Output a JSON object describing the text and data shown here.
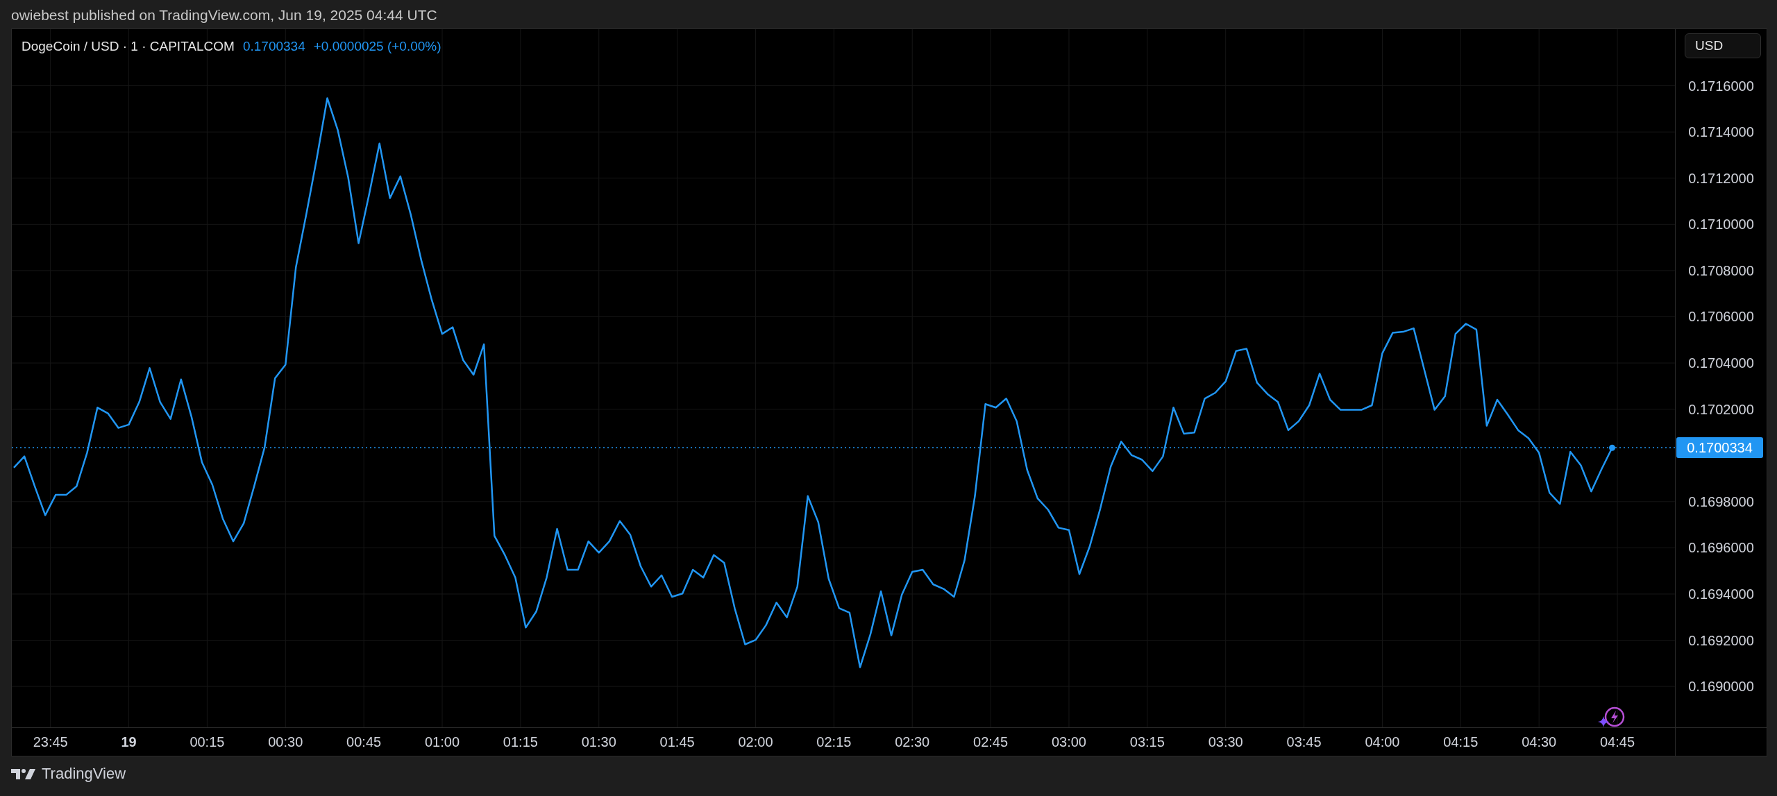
{
  "attribution": "owiebest published on TradingView.com, Jun 19, 2025 04:44 UTC",
  "chart": {
    "symbol": "DogeCoin / USD · 1 · CAPITALCOM",
    "last_price": "0.1700334",
    "change": "+0.0000025 (+0.00%)",
    "currency_button": "USD",
    "chart_data": {
      "type": "line",
      "grid": true,
      "x": [
        "2025-06-18T23:38",
        "2025-06-18T23:40",
        "2025-06-18T23:42",
        "2025-06-18T23:44",
        "2025-06-18T23:46",
        "2025-06-18T23:48",
        "2025-06-18T23:50",
        "2025-06-18T23:52",
        "2025-06-18T23:54",
        "2025-06-18T23:56",
        "2025-06-18T23:58",
        "2025-06-19T00:00",
        "2025-06-19T00:02",
        "2025-06-19T00:04",
        "2025-06-19T00:06",
        "2025-06-19T00:08",
        "2025-06-19T00:10",
        "2025-06-19T00:12",
        "2025-06-19T00:14",
        "2025-06-19T00:16",
        "2025-06-19T00:18",
        "2025-06-19T00:20",
        "2025-06-19T00:22",
        "2025-06-19T00:24",
        "2025-06-19T00:26",
        "2025-06-19T00:28",
        "2025-06-19T00:30",
        "2025-06-19T00:32",
        "2025-06-19T00:34",
        "2025-06-19T00:36",
        "2025-06-19T00:38",
        "2025-06-19T00:40",
        "2025-06-19T00:42",
        "2025-06-19T00:44",
        "2025-06-19T00:46",
        "2025-06-19T00:48",
        "2025-06-19T00:50",
        "2025-06-19T00:52",
        "2025-06-19T00:54",
        "2025-06-19T00:56",
        "2025-06-19T00:58",
        "2025-06-19T01:00",
        "2025-06-19T01:02",
        "2025-06-19T01:04",
        "2025-06-19T01:06",
        "2025-06-19T01:08",
        "2025-06-19T01:10",
        "2025-06-19T01:12",
        "2025-06-19T01:14",
        "2025-06-19T01:16",
        "2025-06-19T01:18",
        "2025-06-19T01:20",
        "2025-06-19T01:22",
        "2025-06-19T01:24",
        "2025-06-19T01:26",
        "2025-06-19T01:28",
        "2025-06-19T01:30",
        "2025-06-19T01:32",
        "2025-06-19T01:34",
        "2025-06-19T01:36",
        "2025-06-19T01:38",
        "2025-06-19T01:40",
        "2025-06-19T01:42",
        "2025-06-19T01:44",
        "2025-06-19T01:46",
        "2025-06-19T01:48",
        "2025-06-19T01:50",
        "2025-06-19T01:52",
        "2025-06-19T01:54",
        "2025-06-19T01:56",
        "2025-06-19T01:58",
        "2025-06-19T02:00",
        "2025-06-19T02:02",
        "2025-06-19T02:04",
        "2025-06-19T02:06",
        "2025-06-19T02:08",
        "2025-06-19T02:10",
        "2025-06-19T02:12",
        "2025-06-19T02:14",
        "2025-06-19T02:16",
        "2025-06-19T02:18",
        "2025-06-19T02:20",
        "2025-06-19T02:22",
        "2025-06-19T02:24",
        "2025-06-19T02:26",
        "2025-06-19T02:28",
        "2025-06-19T02:30",
        "2025-06-19T02:32",
        "2025-06-19T02:34",
        "2025-06-19T02:36",
        "2025-06-19T02:38",
        "2025-06-19T02:40",
        "2025-06-19T02:42",
        "2025-06-19T02:44",
        "2025-06-19T02:46",
        "2025-06-19T02:48",
        "2025-06-19T02:50",
        "2025-06-19T02:52",
        "2025-06-19T02:54",
        "2025-06-19T02:56",
        "2025-06-19T02:58",
        "2025-06-19T03:00",
        "2025-06-19T03:02",
        "2025-06-19T03:04",
        "2025-06-19T03:06",
        "2025-06-19T03:08",
        "2025-06-19T03:10",
        "2025-06-19T03:12",
        "2025-06-19T03:14",
        "2025-06-19T03:16",
        "2025-06-19T03:18",
        "2025-06-19T03:20",
        "2025-06-19T03:22",
        "2025-06-19T03:24",
        "2025-06-19T03:26",
        "2025-06-19T03:28",
        "2025-06-19T03:30",
        "2025-06-19T03:32",
        "2025-06-19T03:34",
        "2025-06-19T03:36",
        "2025-06-19T03:38",
        "2025-06-19T03:40",
        "2025-06-19T03:42",
        "2025-06-19T03:44",
        "2025-06-19T03:46",
        "2025-06-19T03:48",
        "2025-06-19T03:50",
        "2025-06-19T03:52",
        "2025-06-19T03:54",
        "2025-06-19T03:56",
        "2025-06-19T03:58",
        "2025-06-19T04:00",
        "2025-06-19T04:02",
        "2025-06-19T04:04",
        "2025-06-19T04:06",
        "2025-06-19T04:08",
        "2025-06-19T04:10",
        "2025-06-19T04:12",
        "2025-06-19T04:14",
        "2025-06-19T04:16",
        "2025-06-19T04:18",
        "2025-06-19T04:20",
        "2025-06-19T04:22",
        "2025-06-19T04:24",
        "2025-06-19T04:26",
        "2025-06-19T04:28",
        "2025-06-19T04:30",
        "2025-06-19T04:32",
        "2025-06-19T04:34",
        "2025-06-19T04:36",
        "2025-06-19T04:38",
        "2025-06-19T04:40",
        "2025-06-19T04:42",
        "2025-06-19T04:44"
      ],
      "series": [
        {
          "color": "#2196f3",
          "values": [
            0.169947,
            0.169996,
            0.169866,
            0.169741,
            0.169829,
            0.169829,
            0.169866,
            0.170011,
            0.170207,
            0.170182,
            0.170119,
            0.170133,
            0.170231,
            0.170378,
            0.170231,
            0.170158,
            0.170329,
            0.170168,
            0.169971,
            0.169873,
            0.169726,
            0.169628,
            0.169706,
            0.169866,
            0.170035,
            0.170334,
            0.170393,
            0.170815,
            0.171046,
            0.171286,
            0.171546,
            0.171409,
            0.171203,
            0.170918,
            0.171129,
            0.17135,
            0.171114,
            0.171208,
            0.171041,
            0.170845,
            0.170673,
            0.170526,
            0.170555,
            0.170413,
            0.170349,
            0.170481,
            0.169652,
            0.169569,
            0.169471,
            0.169255,
            0.169324,
            0.169471,
            0.169682,
            0.169505,
            0.169505,
            0.169628,
            0.169579,
            0.169628,
            0.169716,
            0.169657,
            0.16952,
            0.169432,
            0.169481,
            0.169388,
            0.169402,
            0.169505,
            0.169471,
            0.169569,
            0.169535,
            0.169339,
            0.169182,
            0.169201,
            0.169265,
            0.169363,
            0.169299,
            0.169432,
            0.169824,
            0.169711,
            0.169466,
            0.169339,
            0.169319,
            0.169083,
            0.169226,
            0.169412,
            0.169221,
            0.169397,
            0.169496,
            0.169505,
            0.169442,
            0.169422,
            0.169388,
            0.169545,
            0.169824,
            0.170222,
            0.170207,
            0.170246,
            0.170148,
            0.169937,
            0.169814,
            0.169765,
            0.169687,
            0.169677,
            0.169486,
            0.169608,
            0.16977,
            0.169952,
            0.17006,
            0.170001,
            0.169981,
            0.169932,
            0.169996,
            0.170207,
            0.170094,
            0.170099,
            0.170246,
            0.170271,
            0.17032,
            0.170452,
            0.170462,
            0.170315,
            0.170266,
            0.170231,
            0.170109,
            0.170148,
            0.170217,
            0.170354,
            0.170241,
            0.170197,
            0.170197,
            0.170197,
            0.170217,
            0.170442,
            0.170531,
            0.170535,
            0.17055,
            0.170374,
            0.170197,
            0.170256,
            0.170526,
            0.17057,
            0.170545,
            0.170128,
            0.170241,
            0.170177,
            0.170109,
            0.170074,
            0.170011,
            0.169839,
            0.16979,
            0.170016,
            0.169957,
            0.169844,
            0.169942,
            0.170033
          ]
        }
      ],
      "ref_lines": [
        {
          "axis": "y",
          "value": 0.1700334,
          "label": "0.1700334",
          "color": "#2196f3"
        }
      ],
      "xlim": [
        "2025-06-18T23:37:36",
        "2025-06-19T05:13:42"
      ],
      "ylim": [
        0.168697,
        0.171845
      ],
      "xticks": [
        {
          "value": "2025-06-18T23:45",
          "label": "23:45"
        },
        {
          "value": "2025-06-19T00:00",
          "label": "19"
        },
        {
          "value": "2025-06-19T00:15",
          "label": "00:15"
        },
        {
          "value": "2025-06-19T00:30",
          "label": "00:30"
        },
        {
          "value": "2025-06-19T00:45",
          "label": "00:45"
        },
        {
          "value": "2025-06-19T01:00",
          "label": "01:00"
        },
        {
          "value": "2025-06-19T01:15",
          "label": "01:15"
        },
        {
          "value": "2025-06-19T01:30",
          "label": "01:30"
        },
        {
          "value": "2025-06-19T01:45",
          "label": "01:45"
        },
        {
          "value": "2025-06-19T02:00",
          "label": "02:00"
        },
        {
          "value": "2025-06-19T02:15",
          "label": "02:15"
        },
        {
          "value": "2025-06-19T02:30",
          "label": "02:30"
        },
        {
          "value": "2025-06-19T02:45",
          "label": "02:45"
        },
        {
          "value": "2025-06-19T03:00",
          "label": "03:00"
        },
        {
          "value": "2025-06-19T03:15",
          "label": "03:15"
        },
        {
          "value": "2025-06-19T03:30",
          "label": "03:30"
        },
        {
          "value": "2025-06-19T03:45",
          "label": "03:45"
        },
        {
          "value": "2025-06-19T04:00",
          "label": "04:00"
        },
        {
          "value": "2025-06-19T04:15",
          "label": "04:15"
        },
        {
          "value": "2025-06-19T04:30",
          "label": "04:30"
        },
        {
          "value": "2025-06-19T04:45",
          "label": "04:45"
        }
      ],
      "yticks": [
        {
          "value": 0.1716,
          "label": "0.1716000"
        },
        {
          "value": 0.1714,
          "label": "0.1714000"
        },
        {
          "value": 0.1712,
          "label": "0.1712000"
        },
        {
          "value": 0.171,
          "label": "0.1710000"
        },
        {
          "value": 0.1708,
          "label": "0.1708000"
        },
        {
          "value": 0.1706,
          "label": "0.1706000"
        },
        {
          "value": 0.1704,
          "label": "0.1704000"
        },
        {
          "value": 0.1702,
          "label": "0.1702000"
        },
        {
          "value": 0.1698,
          "label": "0.1698000"
        },
        {
          "value": 0.1696,
          "label": "0.1696000"
        },
        {
          "value": 0.1694,
          "label": "0.1694000"
        },
        {
          "value": 0.1692,
          "label": "0.1692000"
        },
        {
          "value": 0.169,
          "label": "0.1690000"
        }
      ]
    }
  },
  "footer": {
    "brand": "TradingView"
  }
}
